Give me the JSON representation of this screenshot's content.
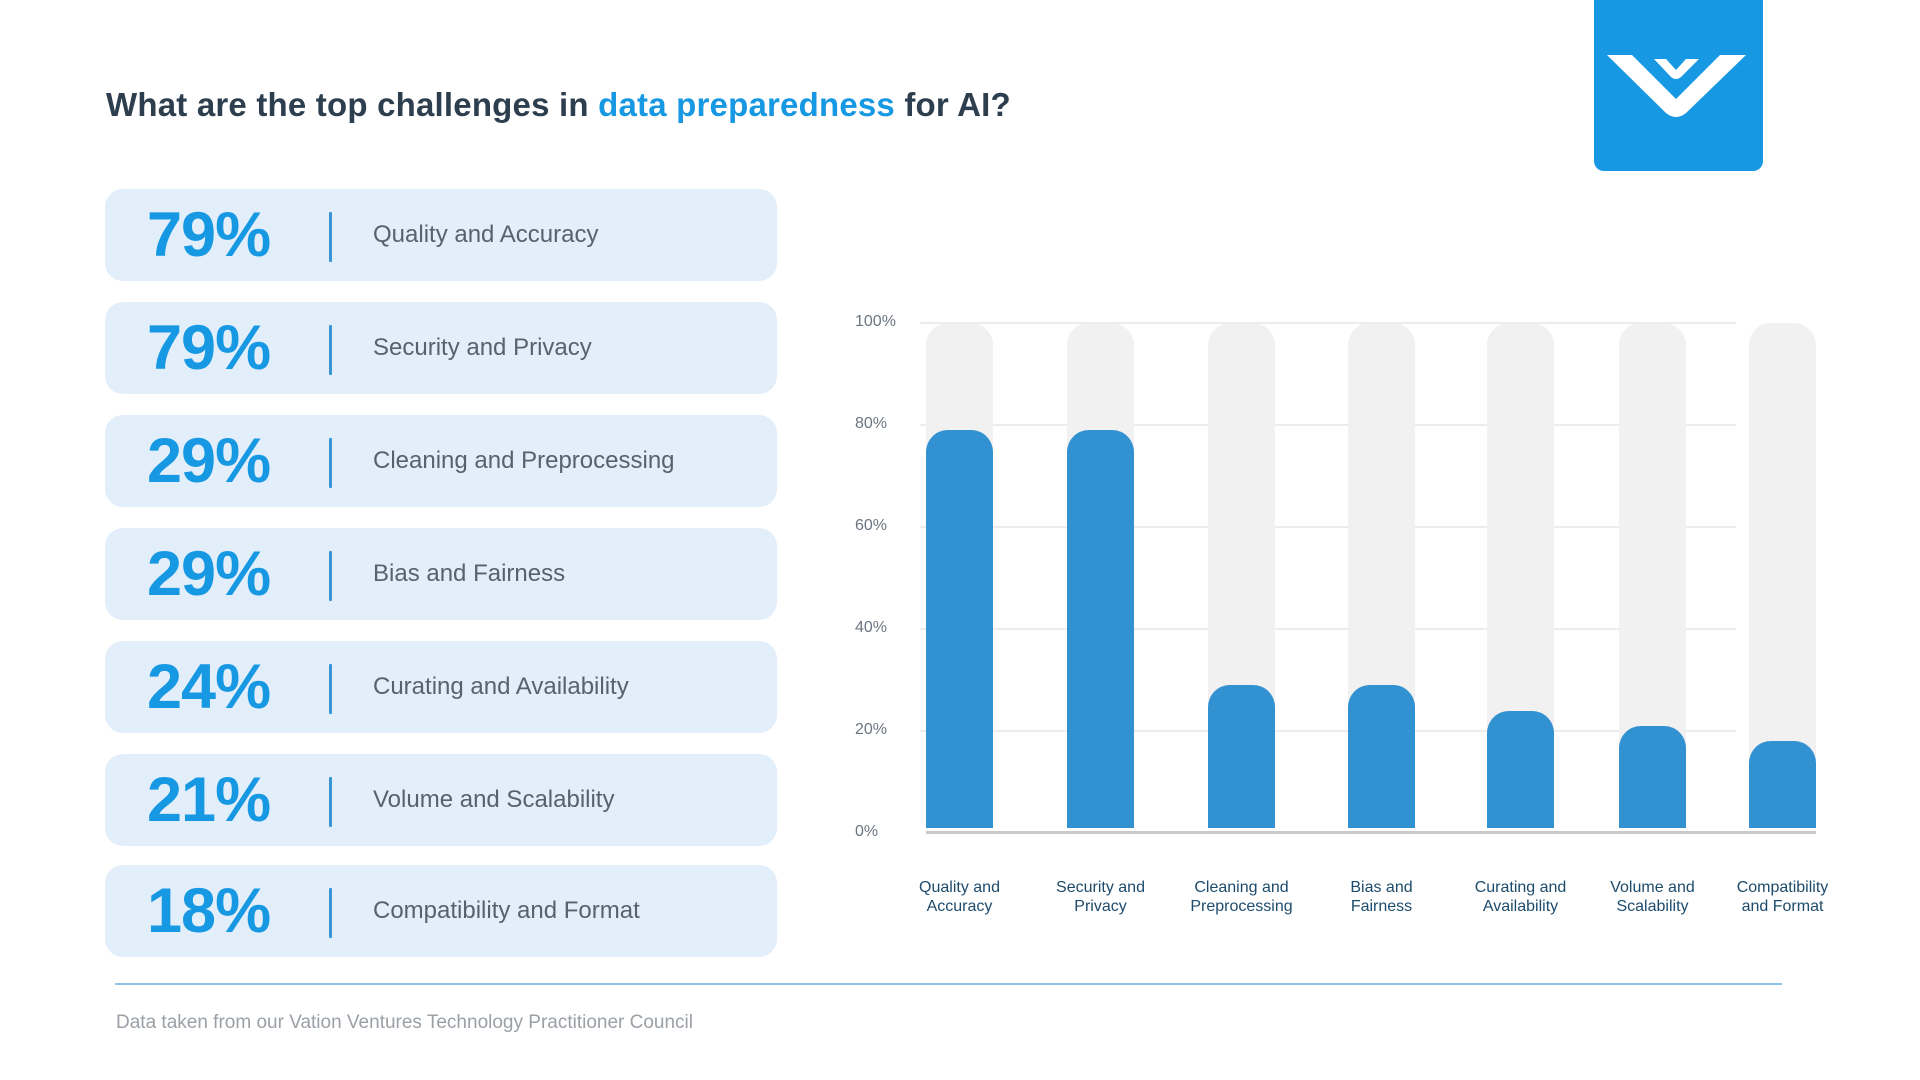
{
  "title": {
    "prefix": "What are the top challenges in ",
    "highlight": "data preparedness",
    "suffix": " for AI?"
  },
  "logo": {
    "icon": "vation-ventures-v-logo",
    "color": "#1798e2"
  },
  "cards": [
    {
      "percent": "79%",
      "label": "Quality and Accuracy"
    },
    {
      "percent": "79%",
      "label": "Security and Privacy"
    },
    {
      "percent": "29%",
      "label": "Cleaning and Preprocessing"
    },
    {
      "percent": "29%",
      "label": "Bias and Fairness"
    },
    {
      "percent": "24%",
      "label": "Curating and Availability"
    },
    {
      "percent": "21%",
      "label": "Volume and Scalability"
    },
    {
      "percent": "18%",
      "label": "Compatibility and Format"
    }
  ],
  "colors": {
    "accent": "#1798e2",
    "bar_fill": "#3291d0",
    "bar_track": "#f1f1f1",
    "card_bg": "#e3eefb",
    "title": "#2d3e4e"
  },
  "chart_data": {
    "type": "bar",
    "title": "",
    "xlabel": "",
    "ylabel": "",
    "categories": [
      "Quality and\nAccuracy",
      "Security and\nPrivacy",
      "Cleaning and\nPreprocessing",
      "Bias and\nFairness",
      "Curating and\nAvailability",
      "Volume and\nScalability",
      "Compatibility\nand Format"
    ],
    "values": [
      79,
      79,
      29,
      29,
      24,
      21,
      18
    ],
    "background_max": 100,
    "ylim": [
      0,
      100
    ],
    "yticks": [
      0,
      20,
      40,
      60,
      80,
      100
    ],
    "ytick_labels": [
      "0%",
      "20%",
      "40%",
      "60%",
      "80%",
      "100%"
    ],
    "grid": true,
    "legend": "none"
  },
  "footer": {
    "source_note": "Data taken from our Vation Ventures Technology Practitioner Council"
  }
}
